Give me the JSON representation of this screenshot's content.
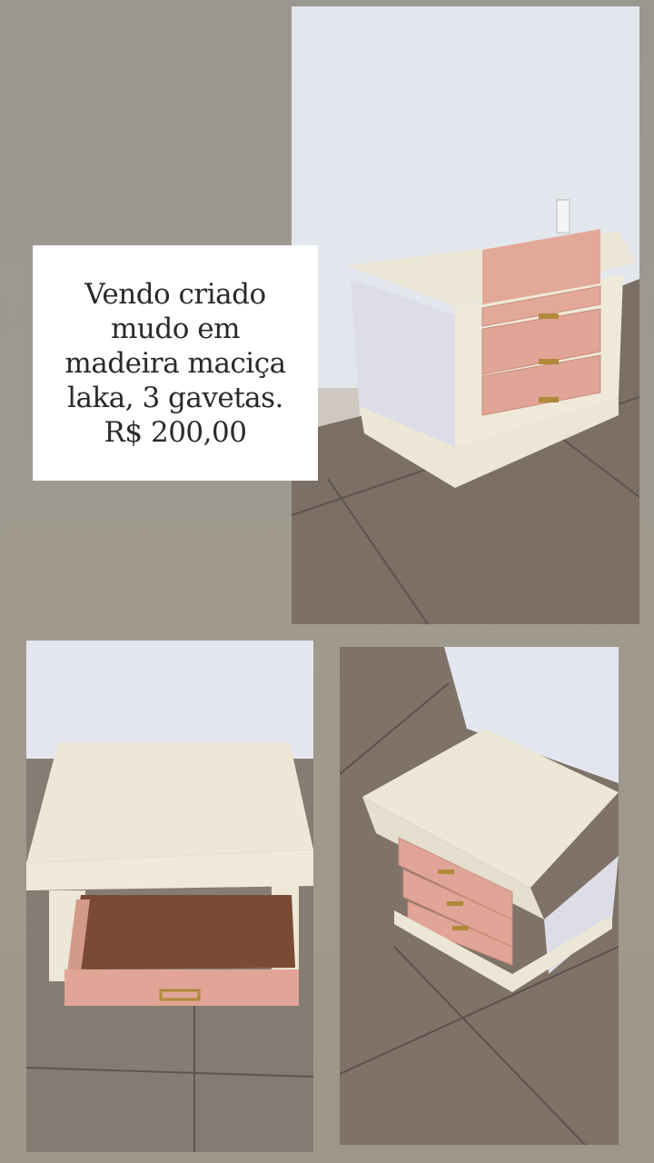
{
  "caption": {
    "lines": [
      "Vendo criado",
      "mudo em",
      "madeira maciça",
      "laka, 3 gavetas.",
      "R$ 200,00"
    ]
  },
  "photos": [
    {
      "subject": "nightstand-front-three-drawers"
    },
    {
      "subject": "nightstand-open-drawer"
    },
    {
      "subject": "nightstand-angled-view"
    }
  ],
  "colors": {
    "background": "#9f9990",
    "wall": "#e6e8ef",
    "floor": "#7d7167",
    "cabinet_white": "#ece7d8",
    "drawer_pink": "#e0a596",
    "handle_gold": "#b08a3a"
  }
}
